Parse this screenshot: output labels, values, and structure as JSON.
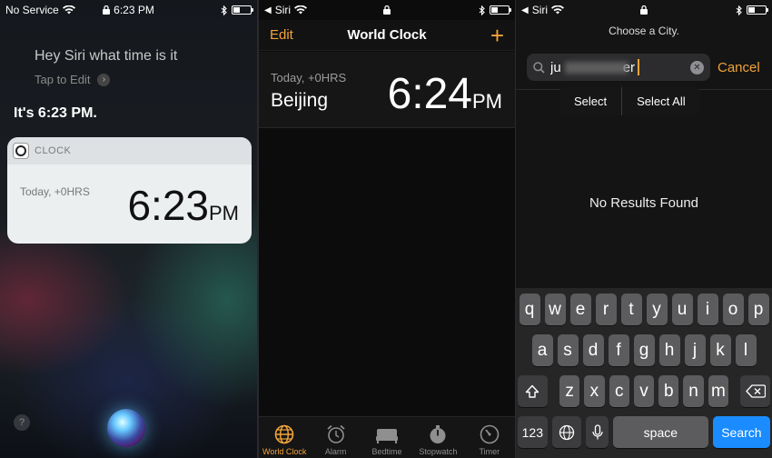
{
  "siri": {
    "status": {
      "carrier": "No Service",
      "time": "6:23 PM"
    },
    "query": "Hey Siri what time is it",
    "tap_to_edit": "Tap to Edit",
    "answer": "It's 6:23 PM.",
    "card": {
      "app_label": "CLOCK",
      "offset": "Today, +0HRS",
      "time": "6:23",
      "ampm": "PM"
    },
    "help_label": "?"
  },
  "world_clock": {
    "status": {
      "back_label": "Siri"
    },
    "nav": {
      "edit_label": "Edit",
      "title": "World Clock",
      "add_label": "+"
    },
    "entries": [
      {
        "offset": "Today, +0HRS",
        "city": "Beijing",
        "time": "6:24",
        "ampm": "PM"
      }
    ],
    "tabs": [
      {
        "label": "World Clock",
        "icon": "globe-icon",
        "active": true
      },
      {
        "label": "Alarm",
        "icon": "alarm-icon",
        "active": false
      },
      {
        "label": "Bedtime",
        "icon": "bed-icon",
        "active": false
      },
      {
        "label": "Stopwatch",
        "icon": "stopwatch-icon",
        "active": false
      },
      {
        "label": "Timer",
        "icon": "timer-icon",
        "active": false
      }
    ],
    "accent": "#f2a33a"
  },
  "city_search": {
    "status": {
      "back_label": "Siri"
    },
    "prompt": "Choose a City.",
    "search_value": "ju",
    "search_value_end": "er",
    "cancel_label": "Cancel",
    "edit_menu": {
      "select": "Select",
      "select_all": "Select All"
    },
    "no_results": "No Results Found",
    "keyboard": {
      "row1": [
        "q",
        "w",
        "e",
        "r",
        "t",
        "y",
        "u",
        "i",
        "o",
        "p"
      ],
      "row2": [
        "a",
        "s",
        "d",
        "f",
        "g",
        "h",
        "j",
        "k",
        "l"
      ],
      "row3": [
        "z",
        "x",
        "c",
        "v",
        "b",
        "n",
        "m"
      ],
      "num_label": "123",
      "space_label": "space",
      "search_label": "Search"
    }
  }
}
